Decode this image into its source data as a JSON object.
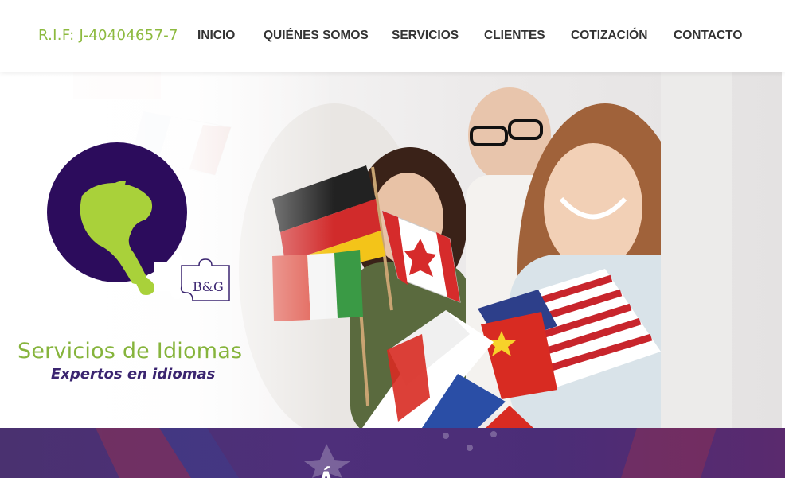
{
  "header": {
    "rif": "R.I.F: J-40404657-7",
    "nav": [
      {
        "label": "INICIO"
      },
      {
        "label": "QUIÉNES SOMOS"
      },
      {
        "label": "SERVICIOS"
      },
      {
        "label": "CLIENTES"
      },
      {
        "label": "COTIZACIÓN"
      },
      {
        "label": "CONTACTO"
      }
    ]
  },
  "logo": {
    "mark": "B&G",
    "title": "Servicios de Idiomas",
    "tagline": "Expertos en idiomas"
  },
  "band": {
    "heading": "Á"
  },
  "colors": {
    "brand_green": "#86b43c",
    "brand_purple": "#3b2570",
    "band_purple": "#4e2f7a",
    "nav_text": "#333333"
  }
}
